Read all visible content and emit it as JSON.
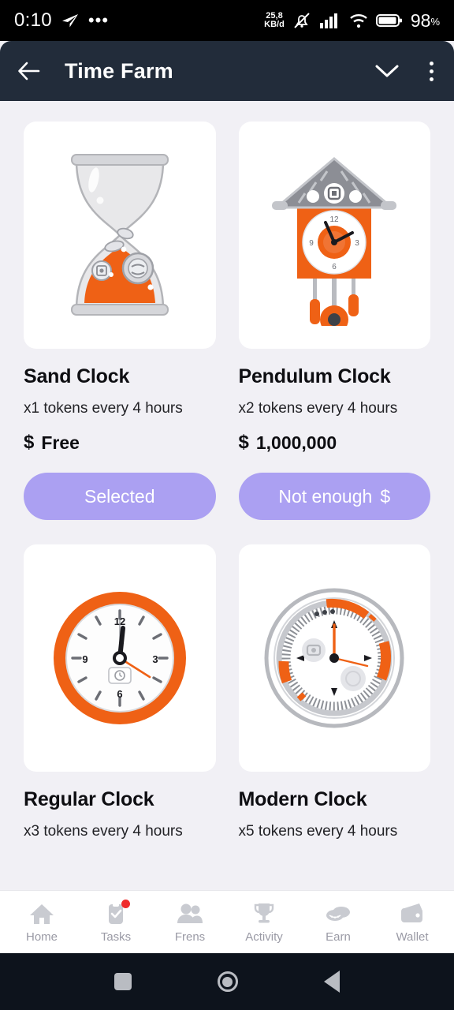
{
  "status_bar": {
    "time": "0:10",
    "telegram_icon": "telegram-send-icon",
    "overflow": "•••",
    "network_speed_value": "25,8",
    "network_speed_unit": "KB/d",
    "silent_icon": "bell-muted-icon",
    "signal_icon": "signal-bars-icon",
    "wifi_icon": "wifi-icon",
    "battery_icon": "battery-icon",
    "battery_percent": "98",
    "battery_percent_symbol": "%"
  },
  "app_bar": {
    "back_icon": "back-arrow-icon",
    "title": "Time Farm",
    "collapse_icon": "chevron-down-icon",
    "menu_icon": "kebab-menu-icon",
    "background": "#222c3a"
  },
  "theme": {
    "page_background": "#f1f0f5",
    "card_background": "#ffffff",
    "accent_orange": "#ef6115",
    "button_purple": "#aba0f2",
    "badge_red": "#ef2b2b"
  },
  "items": [
    {
      "name": "Sand Clock",
      "rate": "x1 tokens every 4 hours",
      "price_symbol": "$",
      "price": "Free",
      "cta_label": "Selected",
      "cta_suffix": "",
      "art": "hourglass"
    },
    {
      "name": "Pendulum Clock",
      "rate": "x2 tokens every 4 hours",
      "price_symbol": "$",
      "price": "1,000,000",
      "cta_label": "Not enough",
      "cta_suffix": "$",
      "art": "cuckoo-clock"
    },
    {
      "name": "Regular Clock",
      "rate": "x3 tokens every 4 hours",
      "price_symbol": "$",
      "price": "",
      "cta_label": "",
      "cta_suffix": "",
      "art": "wall-clock"
    },
    {
      "name": "Modern Clock",
      "rate": "x5 tokens every 4 hours",
      "price_symbol": "$",
      "price": "",
      "cta_label": "",
      "cta_suffix": "",
      "art": "modern-clock"
    }
  ],
  "bottom_nav": [
    {
      "label": "Home",
      "icon": "home-icon",
      "badge": false
    },
    {
      "label": "Tasks",
      "icon": "tasks-icon",
      "badge": true
    },
    {
      "label": "Frens",
      "icon": "frens-icon",
      "badge": false
    },
    {
      "label": "Activity",
      "icon": "trophy-icon",
      "badge": false
    },
    {
      "label": "Earn",
      "icon": "coins-icon",
      "badge": false
    },
    {
      "label": "Wallet",
      "icon": "wallet-icon",
      "badge": false
    }
  ],
  "android_nav": {
    "recents": "recents-square-icon",
    "home": "home-circle-icon",
    "back": "back-triangle-icon"
  }
}
